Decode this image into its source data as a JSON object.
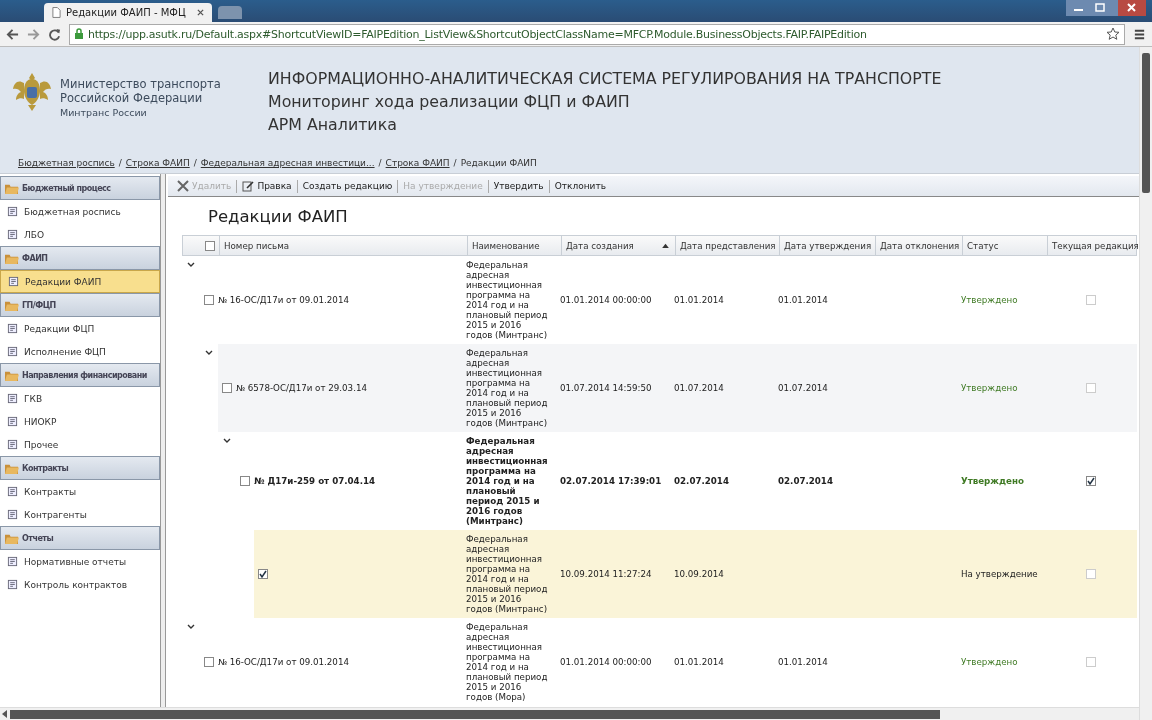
{
  "browser": {
    "tabs": [
      {
        "title": "Редакции ФАИП - МФЦ",
        "selected": true
      },
      {
        "selected": false
      }
    ],
    "url": "https://upp.asutk.ru/Default.aspx#ShortcutViewID=FAIPEdition_ListView&ShortcutObjectClassName=MFCP.Module.BusinessObjects.FAIP.FAIPEdition"
  },
  "header": {
    "org_lines": [
      "Министерство транспорта",
      "Российской Федерации"
    ],
    "org_short": "Минтранс России",
    "titles": [
      "ИНФОРМАЦИОННО-АНАЛИТИЧЕСКАЯ СИСТЕМА РЕГУЛИРОВАНИЯ НА ТРАНСПОРТЕ",
      "Мониторинг хода реализации ФЦП и ФАИП",
      "АРМ Аналитика"
    ]
  },
  "breadcrumb_separator": "/",
  "breadcrumbs": [
    {
      "label": "Бюджетная роспись",
      "link": true
    },
    {
      "label": "Строка ФАИП",
      "link": true
    },
    {
      "label": "Федеральная адресная инвестици...",
      "link": true
    },
    {
      "label": "Строка ФАИП",
      "link": true
    },
    {
      "label": "Редакции ФАИП",
      "link": false
    }
  ],
  "sidebar": [
    {
      "label": "Бюджетный процесс",
      "items": [
        {
          "label": "Бюджетная роспись",
          "selected": false
        },
        {
          "label": "ЛБО",
          "selected": false
        }
      ]
    },
    {
      "label": "ФАИП",
      "items": [
        {
          "label": "Редакции ФАИП",
          "selected": true
        }
      ]
    },
    {
      "label": "ГП/ФЦП",
      "items": [
        {
          "label": "Редакции ФЦП",
          "selected": false
        },
        {
          "label": "Исполнение ФЦП",
          "selected": false
        }
      ]
    },
    {
      "label": "Направления финансировани",
      "items": [
        {
          "label": "ГКВ",
          "selected": false
        },
        {
          "label": "НИОКР",
          "selected": false
        },
        {
          "label": "Прочее",
          "selected": false
        }
      ]
    },
    {
      "label": "Контракты",
      "items": [
        {
          "label": "Контракты",
          "selected": false
        },
        {
          "label": "Контрагенты",
          "selected": false
        }
      ]
    },
    {
      "label": "Отчеты",
      "items": [
        {
          "label": "Нормативные отчеты",
          "selected": false
        },
        {
          "label": "Контроль контрактов",
          "selected": false
        }
      ]
    }
  ],
  "toolbar": [
    {
      "label": "Удалить",
      "kind": "delete",
      "disabled": true
    },
    {
      "label": "Правка",
      "kind": "edit",
      "disabled": false
    },
    {
      "label": "Создать редакцию",
      "kind": "text",
      "disabled": false
    },
    {
      "label": "На утверждение",
      "kind": "text",
      "disabled": true
    },
    {
      "label": "Утвердить",
      "kind": "text",
      "disabled": false
    },
    {
      "label": "Отклонить",
      "kind": "text",
      "disabled": false
    }
  ],
  "page_title": "Редакции ФАИП",
  "table": {
    "select_all_checked": false,
    "columns": [
      {
        "label": "Номер письма"
      },
      {
        "label": "Наименование"
      },
      {
        "label": "Дата создания",
        "sorted": true
      },
      {
        "label": "Дата представления"
      },
      {
        "label": "Дата утверждения"
      },
      {
        "label": "Дата отклонения"
      },
      {
        "label": "Статус"
      },
      {
        "label": "Текущая редакция"
      }
    ],
    "rows": [
      {
        "number": "№ 16-ОС/Д17и от 09.01.2014",
        "name": "Федеральная адресная инвестиционная программа на 2014 год и на плановый период 2015 и 2016 годов (Минтранс)",
        "created": "01.01.2014 00:00:00",
        "submitted": "01.01.2014",
        "approved": "01.01.2014",
        "status": {
          "text": "Утверждено",
          "approved": true
        },
        "current": false,
        "checked": false,
        "selected": false,
        "expanded": true,
        "children": [
          {
            "number": "№ 6578-ОС/Д17и от 29.03.14",
            "name": "Федеральная адресная инвестиционная программа на 2014 год и на плановый период 2015 и 2016 годов (Минтранс)",
            "created": "01.07.2014 14:59:50",
            "submitted": "01.07.2014",
            "approved": "01.07.2014",
            "status": {
              "text": "Утверждено",
              "approved": true
            },
            "current": false,
            "checked": false,
            "selected": false,
            "expanded": true,
            "children": [
              {
                "number": "№ Д17и-259 от 07.04.14",
                "name": "Федеральная адресная инвестиционная программа на 2014 год и на плановый период 2015 и 2016 годов (Минтранс)",
                "created": "02.07.2014 17:39:01",
                "submitted": "02.07.2014",
                "approved": "02.07.2014",
                "status": {
                  "text": "Утверждено",
                  "approved": true
                },
                "current": true,
                "checked": false,
                "selected": false,
                "expanded": true,
                "children": [
                  {
                    "name": "Федеральная адресная инвестиционная программа на 2014 год и на плановый период 2015 и 2016 годов (Минтранс)",
                    "created": "10.09.2014 11:27:24",
                    "submitted": "10.09.2014",
                    "status": {
                      "text": "На утверждение",
                      "approved": false
                    },
                    "current": false,
                    "checked": true,
                    "selected": true
                  }
                ]
              }
            ]
          }
        ]
      },
      {
        "number": "№ 16-ОС/Д17и от 09.01.2014",
        "name": "Федеральная адресная инвестиционная программа на 2014 год и на плановый период 2015 и 2016 годов (Мора)",
        "created": "01.01.2014 00:00:00",
        "submitted": "01.01.2014",
        "approved": "01.01.2014",
        "status": {
          "text": "Утверждено",
          "approved": true
        },
        "current": false,
        "checked": false,
        "selected": false,
        "expanded": true
      }
    ]
  }
}
